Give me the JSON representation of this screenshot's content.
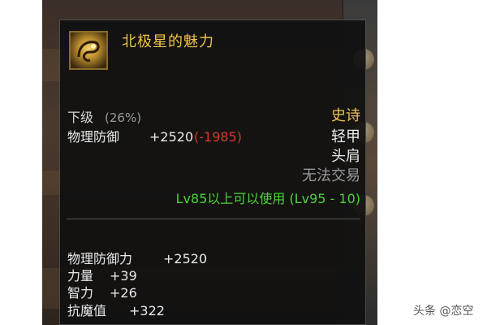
{
  "item": {
    "name": "北极星的魅力",
    "grade_label": "下级",
    "grade_percent": "(26%)",
    "rarity": "史诗",
    "defense_label": "物理防御",
    "defense_value": "+2520",
    "defense_diff": "(-1985)",
    "armor_type": "轻甲",
    "slot": "头肩",
    "trade_status": "无法交易",
    "level_requirement": "Lv85以上可以使用 (Lv95 - 10)",
    "icon": "gold-shoulder-armor-icon"
  },
  "stats": [
    {
      "label": "物理防御力",
      "value": "+2520"
    },
    {
      "label": "力量",
      "value": "+39"
    },
    {
      "label": "智力",
      "value": "+26"
    },
    {
      "label": "抗魔值",
      "value": "+322"
    }
  ],
  "watermark": "头条 @恋空",
  "colors": {
    "name": "#f0c24a",
    "rarity": "#f0c24a",
    "requirement": "#4cd23a",
    "diff": "#d23a2a",
    "tooltip_bg": "#101010"
  }
}
